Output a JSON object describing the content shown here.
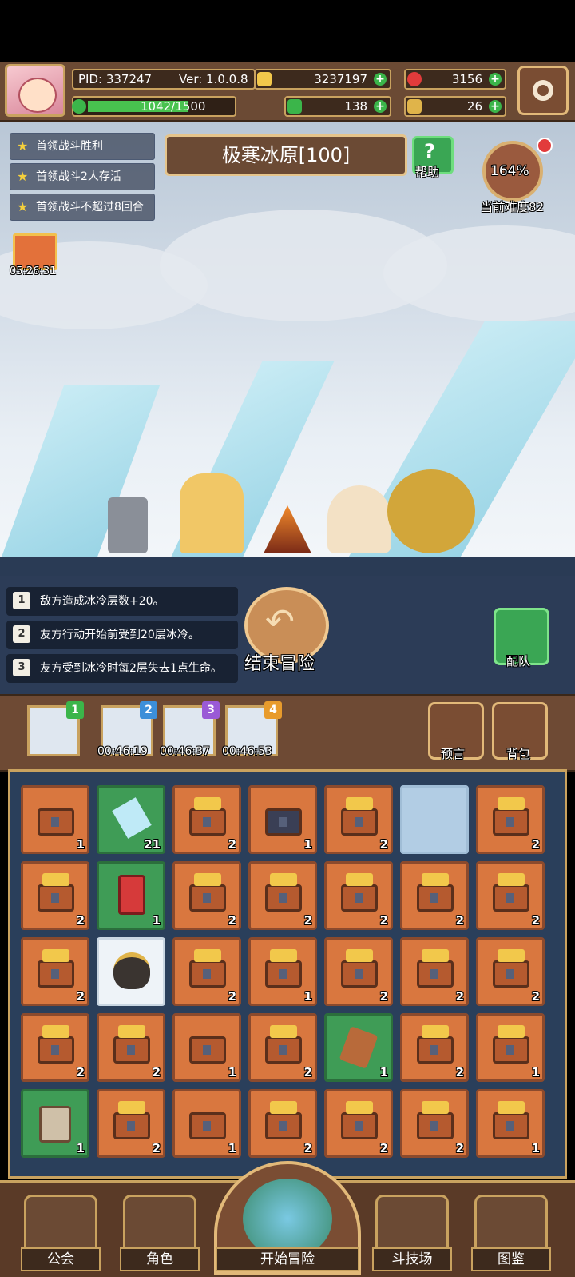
{
  "header": {
    "pid": "PID: 337247",
    "version": "Ver: 1.0.0.8",
    "gold": "3237197",
    "gems": "3156",
    "energy": "1042/1500",
    "clover": "138",
    "key": "26"
  },
  "quests": [
    "首领战斗胜利",
    "首领战斗2人存活",
    "首领战斗不超过8回合"
  ],
  "stage": {
    "title": "极寒冰原[100]",
    "help_label": "帮助"
  },
  "difficulty": {
    "percent": "164%",
    "label": "当前难度82"
  },
  "gift_timer": "05:26:31",
  "rules": [
    {
      "num": "1",
      "text": "敌方造成冰冷层数+20。"
    },
    {
      "num": "2",
      "text": "友方行动开始前受到20层冰冷。"
    },
    {
      "num": "3",
      "text": "友方受到冰冷时每2层失去1点生命。"
    }
  ],
  "end_button": "结束冒险",
  "team_button": "配队",
  "slots": [
    {
      "num": "1",
      "timer": ""
    },
    {
      "num": "2",
      "timer": "00:46:19"
    },
    {
      "num": "3",
      "timer": "00:46:37"
    },
    {
      "num": "4",
      "timer": "00:46:53"
    }
  ],
  "side_buttons": {
    "prophecy": "预言",
    "bag": "背包"
  },
  "inventory": [
    [
      "1",
      "21",
      "2",
      "1",
      "2",
      "",
      "2"
    ],
    [
      "2",
      "1",
      "2",
      "2",
      "2",
      "2",
      "2"
    ],
    [
      "2",
      "",
      "2",
      "1",
      "2",
      "2",
      "2"
    ],
    [
      "2",
      "2",
      "1",
      "2",
      "1",
      "2",
      "1"
    ],
    [
      "1",
      "2",
      "1",
      "2",
      "2",
      "2",
      "1"
    ]
  ],
  "nav": {
    "guild": "公会",
    "role": "角色",
    "start": "开始冒险",
    "arena": "斗技场",
    "codex": "图鉴"
  },
  "colors": {
    "panel_brown": "#6b4a34",
    "gold_border": "#c9a25f",
    "chest_orange": "#d9773f",
    "item_green": "#3f9c56"
  }
}
